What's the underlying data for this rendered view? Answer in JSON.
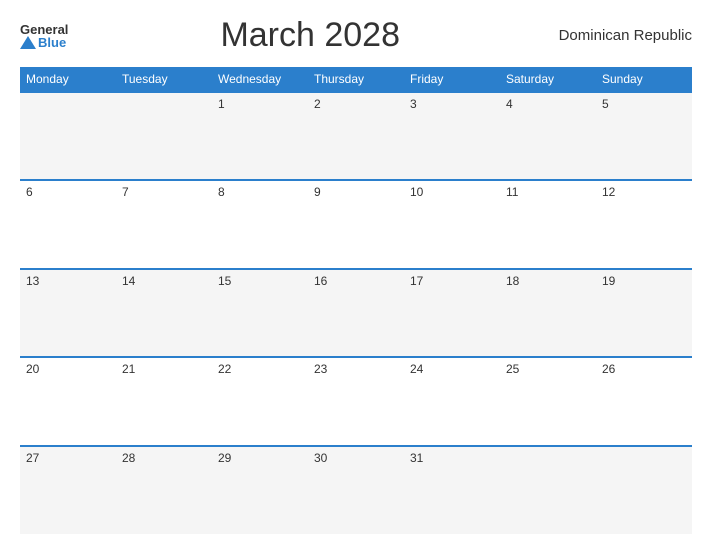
{
  "header": {
    "logo_general": "General",
    "logo_blue": "Blue",
    "title": "March 2028",
    "country": "Dominican Republic"
  },
  "calendar": {
    "days": [
      "Monday",
      "Tuesday",
      "Wednesday",
      "Thursday",
      "Friday",
      "Saturday",
      "Sunday"
    ],
    "weeks": [
      [
        "",
        "",
        "1",
        "2",
        "3",
        "4",
        "5"
      ],
      [
        "6",
        "7",
        "8",
        "9",
        "10",
        "11",
        "12"
      ],
      [
        "13",
        "14",
        "15",
        "16",
        "17",
        "18",
        "19"
      ],
      [
        "20",
        "21",
        "22",
        "23",
        "24",
        "25",
        "26"
      ],
      [
        "27",
        "28",
        "29",
        "30",
        "31",
        "",
        ""
      ]
    ]
  }
}
